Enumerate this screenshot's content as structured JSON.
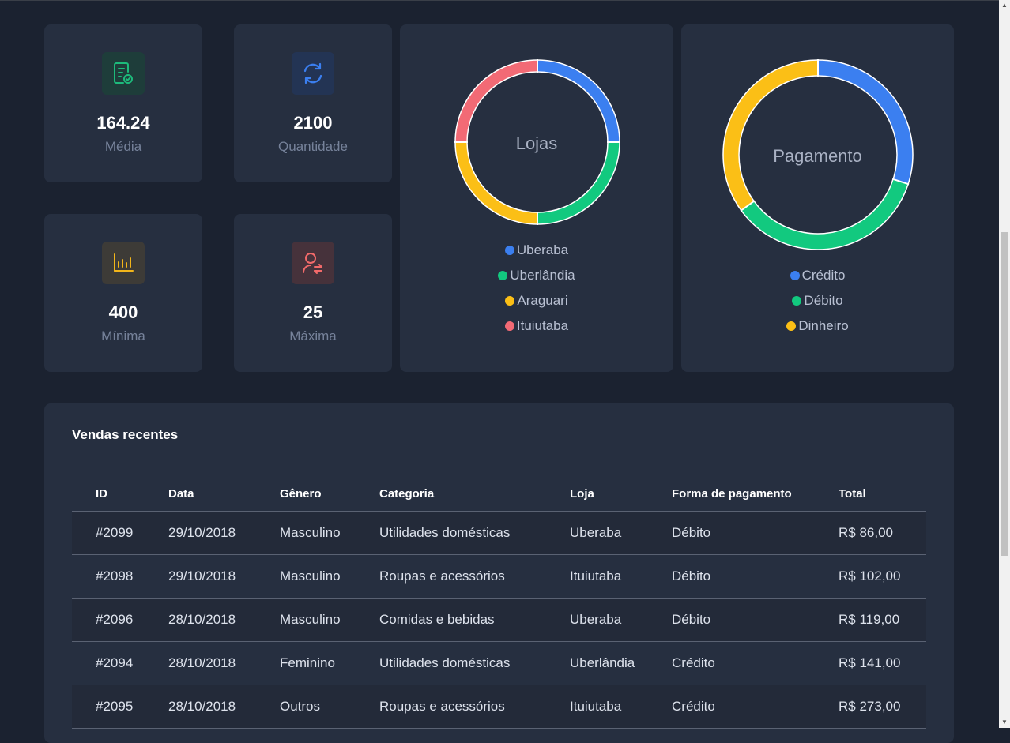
{
  "stats": [
    {
      "value": "164.24",
      "label": "Média",
      "icon": "receipt-check-icon",
      "color": "#1dba7b",
      "bg": "#1e3d3a"
    },
    {
      "value": "2100",
      "label": "Quantidade",
      "icon": "refresh-icon",
      "color": "#3b7ff0",
      "bg": "#233454"
    },
    {
      "value": "400",
      "label": "Mínima",
      "icon": "bar-chart-icon",
      "color": "#f2b51a",
      "bg": "#3d3b37"
    },
    {
      "value": "25",
      "label": "Máxima",
      "icon": "user-exchange-icon",
      "color": "#f26a6a",
      "bg": "#46323b"
    }
  ],
  "chart_data": [
    {
      "type": "pie",
      "title": "Lojas",
      "categories": [
        "Uberaba",
        "Uberlândia",
        "Araguari",
        "Ituiutaba"
      ],
      "values": [
        25,
        25,
        25,
        25
      ],
      "colors": [
        "#3b7ff0",
        "#12c97f",
        "#fbbf16",
        "#f26a75"
      ],
      "legend": "bottom"
    },
    {
      "type": "pie",
      "title": "Pagamento",
      "categories": [
        "Crédito",
        "Débito",
        "Dinheiro"
      ],
      "values": [
        30,
        35,
        35
      ],
      "colors": [
        "#3b7ff0",
        "#12c97f",
        "#fbbf16"
      ],
      "legend": "bottom"
    }
  ],
  "table": {
    "title": "Vendas recentes",
    "columns": [
      "ID",
      "Data",
      "Gênero",
      "Categoria",
      "Loja",
      "Forma de pagamento",
      "Total"
    ],
    "rows": [
      [
        "#2099",
        "29/10/2018",
        "Masculino",
        "Utilidades domésticas",
        "Uberaba",
        "Débito",
        "R$ 86,00"
      ],
      [
        "#2098",
        "29/10/2018",
        "Masculino",
        "Roupas e acessórios",
        "Ituiutaba",
        "Débito",
        "R$ 102,00"
      ],
      [
        "#2096",
        "28/10/2018",
        "Masculino",
        "Comidas e bebidas",
        "Uberaba",
        "Débito",
        "R$ 119,00"
      ],
      [
        "#2094",
        "28/10/2018",
        "Feminino",
        "Utilidades domésticas",
        "Uberlândia",
        "Crédito",
        "R$ 141,00"
      ],
      [
        "#2095",
        "28/10/2018",
        "Outros",
        "Roupas e acessórios",
        "Ituiutaba",
        "Crédito",
        "R$ 273,00"
      ]
    ]
  }
}
